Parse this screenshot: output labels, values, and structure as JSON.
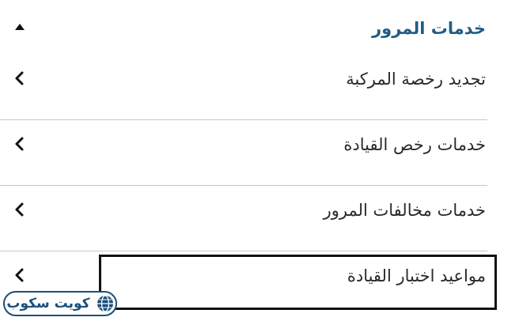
{
  "section": {
    "title": "خدمات المرور",
    "collapse_icon": "caret-up-icon"
  },
  "items": [
    {
      "label": "تجديد رخصة المركبة",
      "icon": "chevron-left-icon"
    },
    {
      "label": "خدمات رخص القيادة",
      "icon": "chevron-left-icon"
    },
    {
      "label": "خدمات مخالفات المرور",
      "icon": "chevron-left-icon"
    },
    {
      "label": "مواعيد اختبار القيادة",
      "icon": "chevron-left-icon"
    }
  ],
  "watermark": {
    "text": "كويت سكوب",
    "icon": "globe-icon"
  },
  "colors": {
    "accent": "#1f5d86",
    "text": "#2a2a2a",
    "divider": "#c8c8c8",
    "highlight_border": "#111111",
    "watermark": "#1c4f7c"
  }
}
